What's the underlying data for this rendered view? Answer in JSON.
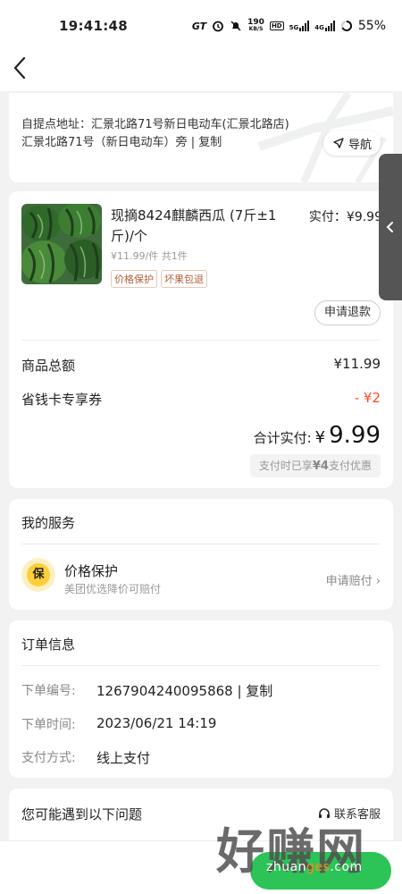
{
  "status_bar": {
    "time": "19:41:48",
    "net_speed_value": "190",
    "net_speed_unit": "KB/S",
    "hd_badge": "HD",
    "signal1_label": "5G",
    "signal2_label": "4G",
    "battery": "55%"
  },
  "address": {
    "line": "自提点地址：汇景北路71号新日电动车(汇景北路店)汇景北路71号（新日电动车）旁 ",
    "copy_label": "| 复制",
    "navigate_label": "导航"
  },
  "product": {
    "title": "现摘8424麒麟西瓜 (7斤±1斤)/个",
    "unit_price": "¥11.99/件  共1件",
    "paid_label": "实付：¥9.99",
    "tags": [
      "价格保护",
      "坏果包退"
    ],
    "refund_button": "申请退款"
  },
  "summary": {
    "goods_total_label": "商品总额",
    "goods_total_value": "¥11.99",
    "coupon_label": "省钱卡专享券",
    "coupon_value": "- ¥2",
    "total_label": "合计实付:",
    "total_symbol": "¥",
    "total_amount": "9.99",
    "pay_hint_prefix": "支付时已享",
    "pay_hint_amount": "¥4",
    "pay_hint_suffix": "支付优惠"
  },
  "services": {
    "title": "我的服务",
    "badge_char": "保",
    "name": "价格保护",
    "desc": "美团优选降价可赔付",
    "claim_label": "申请赔付 ›"
  },
  "order": {
    "title": "订单信息",
    "number_label": "下单编号:",
    "number_value": "1267904240095868 | 复制",
    "time_label": "下单时间:",
    "time_value": "2023/06/21 14:19",
    "pay_label": "支付方式:",
    "pay_value": "线上支付"
  },
  "faq": {
    "title": "您可能遇到以下问题",
    "contact_label": "联系客服"
  },
  "watermark": {
    "big": "好赚网",
    "small_prefix": "zhuan",
    "small_highlight": "ges",
    "small_suffix": ".com"
  },
  "colors": {
    "accent_green": "#2cc456",
    "discount_red": "#ff4a26",
    "badge_yellow": "#ffce3a"
  }
}
